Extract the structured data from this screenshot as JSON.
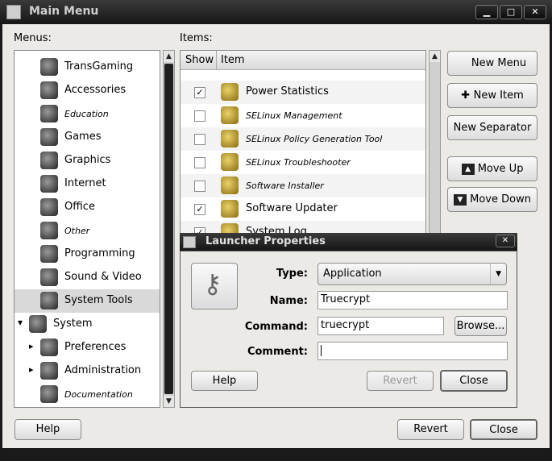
{
  "window": {
    "title": "Main Menu"
  },
  "labels": {
    "menus": "Menus:",
    "items": "Items:"
  },
  "menus_tree": [
    {
      "label": "TransGaming",
      "icon": "transgaming-icon",
      "italic": false
    },
    {
      "label": "Accessories",
      "icon": "accessories-icon",
      "italic": false
    },
    {
      "label": "Education",
      "icon": "education-icon",
      "italic": true
    },
    {
      "label": "Games",
      "icon": "games-icon",
      "italic": false
    },
    {
      "label": "Graphics",
      "icon": "graphics-icon",
      "italic": false
    },
    {
      "label": "Internet",
      "icon": "internet-icon",
      "italic": false
    },
    {
      "label": "Office",
      "icon": "office-icon",
      "italic": false
    },
    {
      "label": "Other",
      "icon": "other-icon",
      "italic": true
    },
    {
      "label": "Programming",
      "icon": "programming-icon",
      "italic": false
    },
    {
      "label": "Sound & Video",
      "icon": "sound-video-icon",
      "italic": false
    },
    {
      "label": "System Tools",
      "icon": "system-tools-icon",
      "italic": false,
      "selected": true
    },
    {
      "label": "System",
      "icon": "system-icon",
      "italic": false,
      "expanded": true
    },
    {
      "label": "Preferences",
      "icon": "preferences-icon",
      "italic": false
    },
    {
      "label": "Administration",
      "icon": "administration-icon",
      "italic": false
    },
    {
      "label": "Documentation",
      "icon": "documentation-icon",
      "italic": true
    }
  ],
  "items_table": {
    "headers": [
      "Show",
      "Item"
    ],
    "rows": [
      {
        "label": "Power Statistics",
        "checked": true,
        "italic": false
      },
      {
        "label": "SELinux Management",
        "checked": false,
        "italic": true
      },
      {
        "label": "SELinux Policy Generation Tool",
        "checked": false,
        "italic": true
      },
      {
        "label": "SELinux Troubleshooter",
        "checked": false,
        "italic": true
      },
      {
        "label": "Software Installer",
        "checked": false,
        "italic": true
      },
      {
        "label": "Software Updater",
        "checked": true,
        "italic": false
      },
      {
        "label": "System Log",
        "checked": true,
        "italic": false
      }
    ]
  },
  "side_buttons": {
    "new_menu": "New Menu",
    "new_item": "New Item",
    "new_separator": "New Separator",
    "move_up": "Move Up",
    "move_down": "Move Down"
  },
  "bottom_buttons": {
    "help": "Help",
    "revert": "Revert",
    "close": "Close"
  },
  "dialog": {
    "title": "Launcher Properties",
    "type_label": "Type:",
    "type_value": "Application",
    "name_label": "Name:",
    "name_value": "Truecrypt",
    "command_label": "Command:",
    "command_value": "truecrypt",
    "browse": "Browse...",
    "comment_label": "Comment:",
    "comment_value": "",
    "help": "Help",
    "revert": "Revert",
    "close": "Close"
  }
}
